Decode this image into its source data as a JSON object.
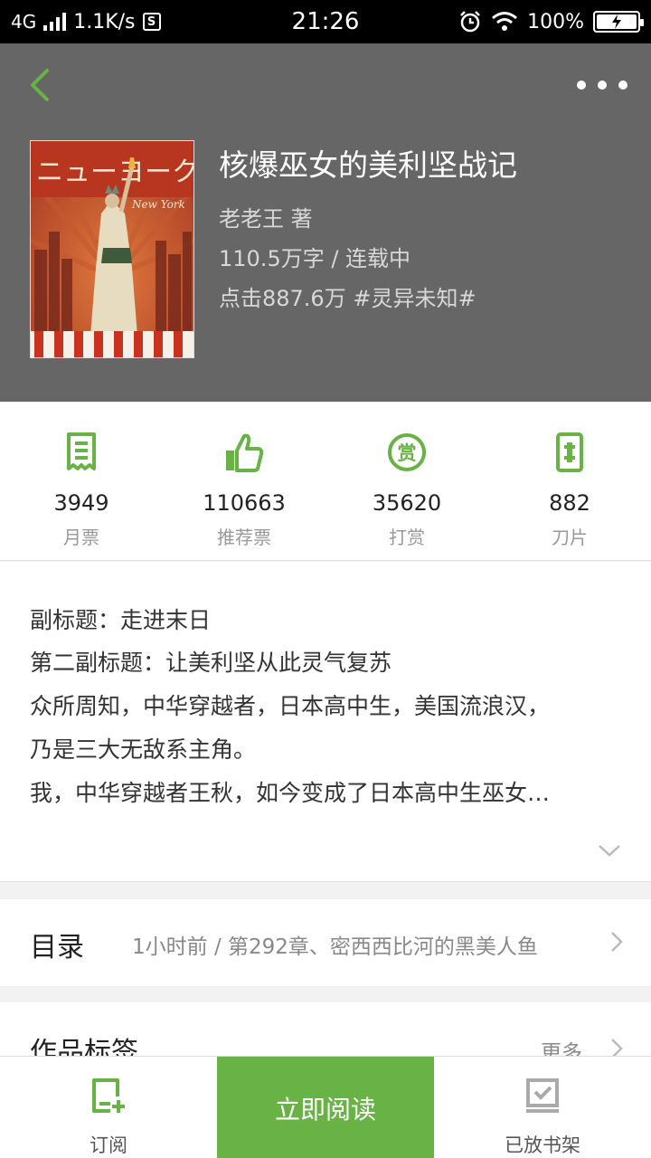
{
  "status_bar": {
    "network": "4G",
    "speed": "1.1K/s",
    "s_badge": "S",
    "time": "21:26",
    "battery": "100%"
  },
  "header": {
    "bg_color": "#666666",
    "accent_color": "#69b245"
  },
  "book": {
    "title": "核爆巫女的美利坚战记",
    "author_line": "老老王  著",
    "words_line": "110.5万字 / 连载中",
    "clicks_line": "点击887.6万  #灵异未知#",
    "cover_text": "ニューヨーク",
    "cover_subtext": "New York"
  },
  "stats": [
    {
      "icon": "monthly-ticket-icon",
      "value": "3949",
      "label": "月票"
    },
    {
      "icon": "thumbs-up-icon",
      "value": "110663",
      "label": "推荐票"
    },
    {
      "icon": "reward-icon",
      "value": "35620",
      "label": "打赏"
    },
    {
      "icon": "blade-icon",
      "value": "882",
      "label": "刀片"
    }
  ],
  "description": {
    "lines": [
      "副标题：走进末日",
      "第二副标题：让美利坚从此灵气复苏",
      "众所周知，中华穿越者，日本高中生，美国流浪汉，",
      "乃是三大无敌系主角。",
      "我，中华穿越者王秋，如今变成了日本高中生巫女…"
    ]
  },
  "toc": {
    "label": "目录",
    "latest": "1小时前 / 第292章、密西西比河的黑美人鱼"
  },
  "tags": {
    "label": "作品标签",
    "more": "更多"
  },
  "bottom_bar": {
    "subscribe": "订阅",
    "read_now": "立即阅读",
    "on_shelf": "已放书架"
  }
}
